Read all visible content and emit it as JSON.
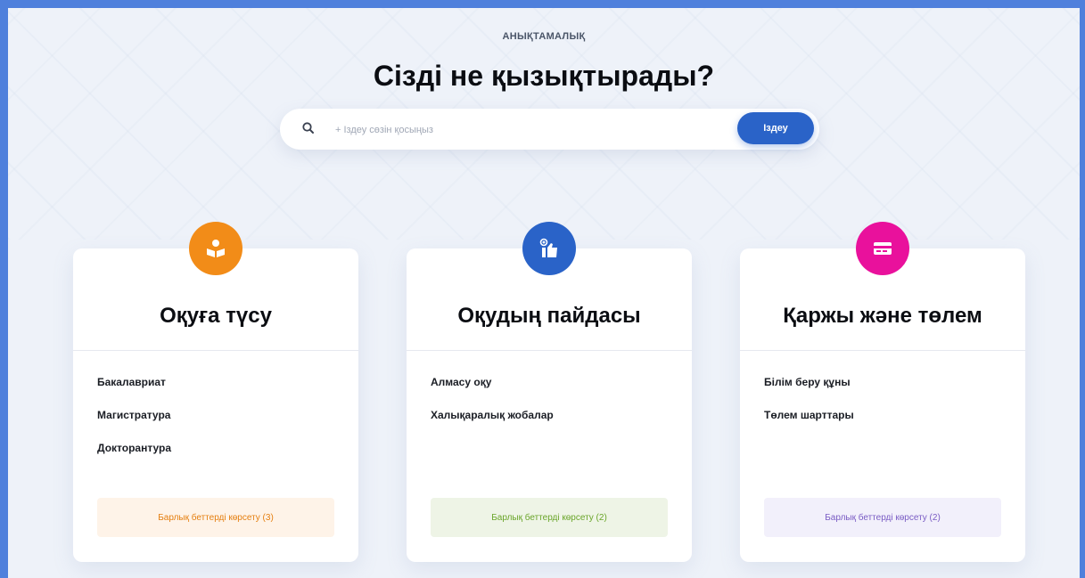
{
  "header": {
    "eyebrow": "АНЫҚТАМАЛЫҚ",
    "title": "Сізді не қызықтырады?"
  },
  "search": {
    "placeholder": "+ Іздеу сөзін қосыңыз",
    "button_label": "Іздеу",
    "icon": "search-icon"
  },
  "cards": [
    {
      "title": "Оқуға түсу",
      "icon": "reading-book-icon",
      "color": "#f28c18",
      "links": [
        "Бакалавриат",
        "Магистратура",
        "Докторантура"
      ],
      "all_label": "Барлық беттерді көрсету (3)",
      "all_bg": "#fef3e8",
      "all_color": "#e57f10"
    },
    {
      "title": "Оқудың пайдасы",
      "icon": "thumbs-up-info-icon",
      "color": "#2a63c8",
      "links": [
        "Алмасу оқу",
        "Халықаралық жобалар"
      ],
      "all_label": "Барлық беттерді көрсету (2)",
      "all_bg": "#eef4e6",
      "all_color": "#6aa52a"
    },
    {
      "title": "Қаржы және төлем",
      "icon": "credit-card-icon",
      "color": "#e9119c",
      "links": [
        "Білім беру құны",
        "Төлем шарттары"
      ],
      "all_label": "Барлық беттерді көрсету (2)",
      "all_bg": "#f2f0fb",
      "all_color": "#7a5cc4"
    }
  ]
}
